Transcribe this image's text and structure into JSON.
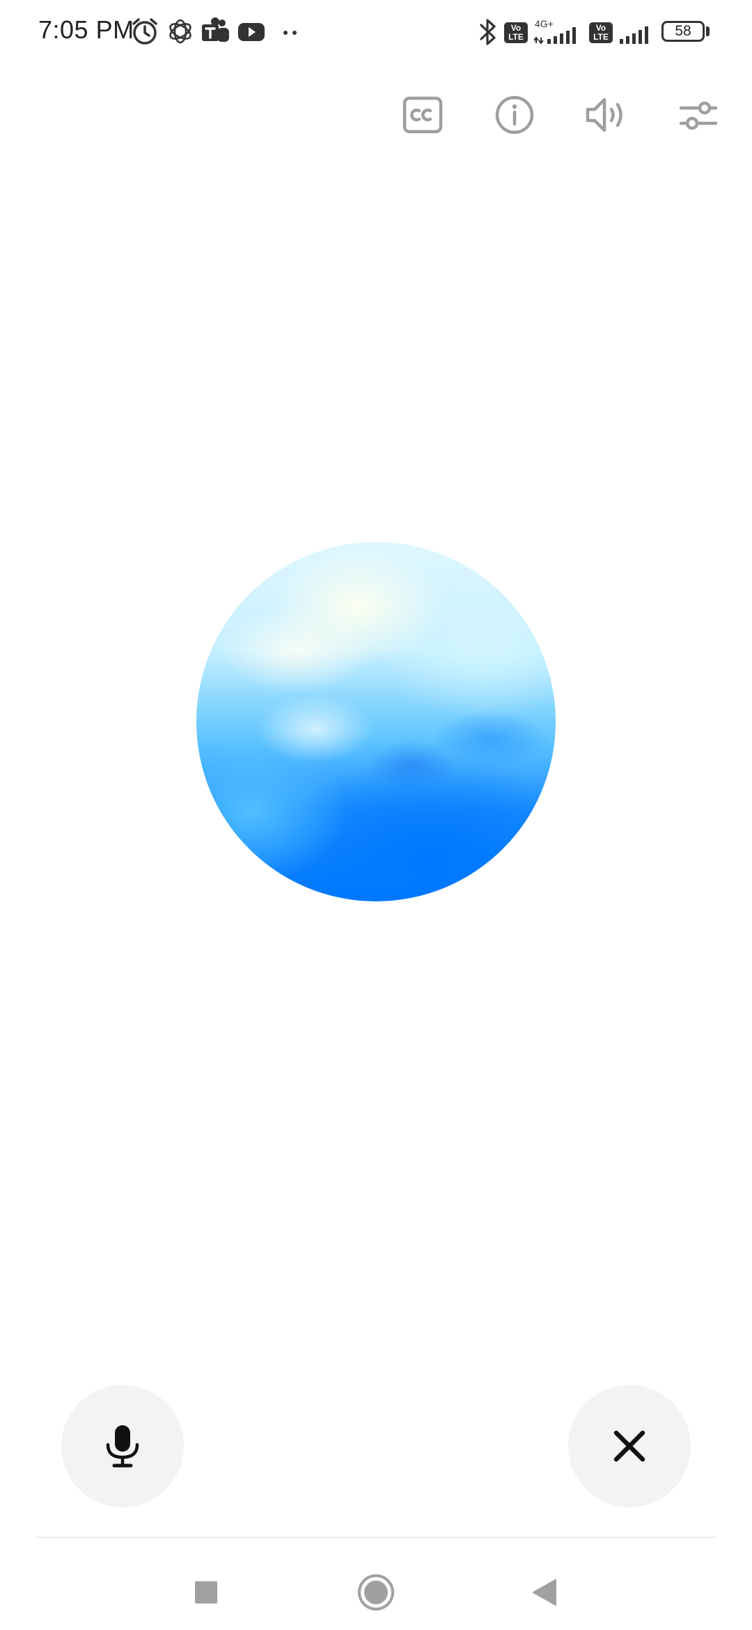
{
  "status_bar": {
    "time": "7:05 PM",
    "battery_level": "58",
    "network_type": "4G+",
    "volte_label_top": "Vo",
    "volte_label_bottom": "LTE",
    "notification_icons": [
      "alarm-icon",
      "openai-icon",
      "teams-icon",
      "youtube-icon",
      "more-dots-icon"
    ],
    "system_icons": [
      "bluetooth-icon",
      "volte-icon",
      "signal-icon",
      "volte-icon",
      "signal-icon",
      "battery-icon"
    ]
  },
  "toolbar": {
    "buttons": [
      "captions-icon",
      "info-icon",
      "speaker-icon",
      "settings-sliders-icon"
    ],
    "icon_color": "#9e9e9e"
  },
  "orb": {
    "colors": [
      "#dff7ff",
      "#5fc5ff",
      "#0077ff"
    ]
  },
  "controls": {
    "left_button_icon": "microphone-icon",
    "right_button_icon": "close-icon",
    "button_background": "#f3f3f3"
  },
  "nav_bar": {
    "buttons": [
      "recents-square-icon",
      "home-circle-icon",
      "back-triangle-icon"
    ],
    "icon_color": "#a0a0a0"
  }
}
